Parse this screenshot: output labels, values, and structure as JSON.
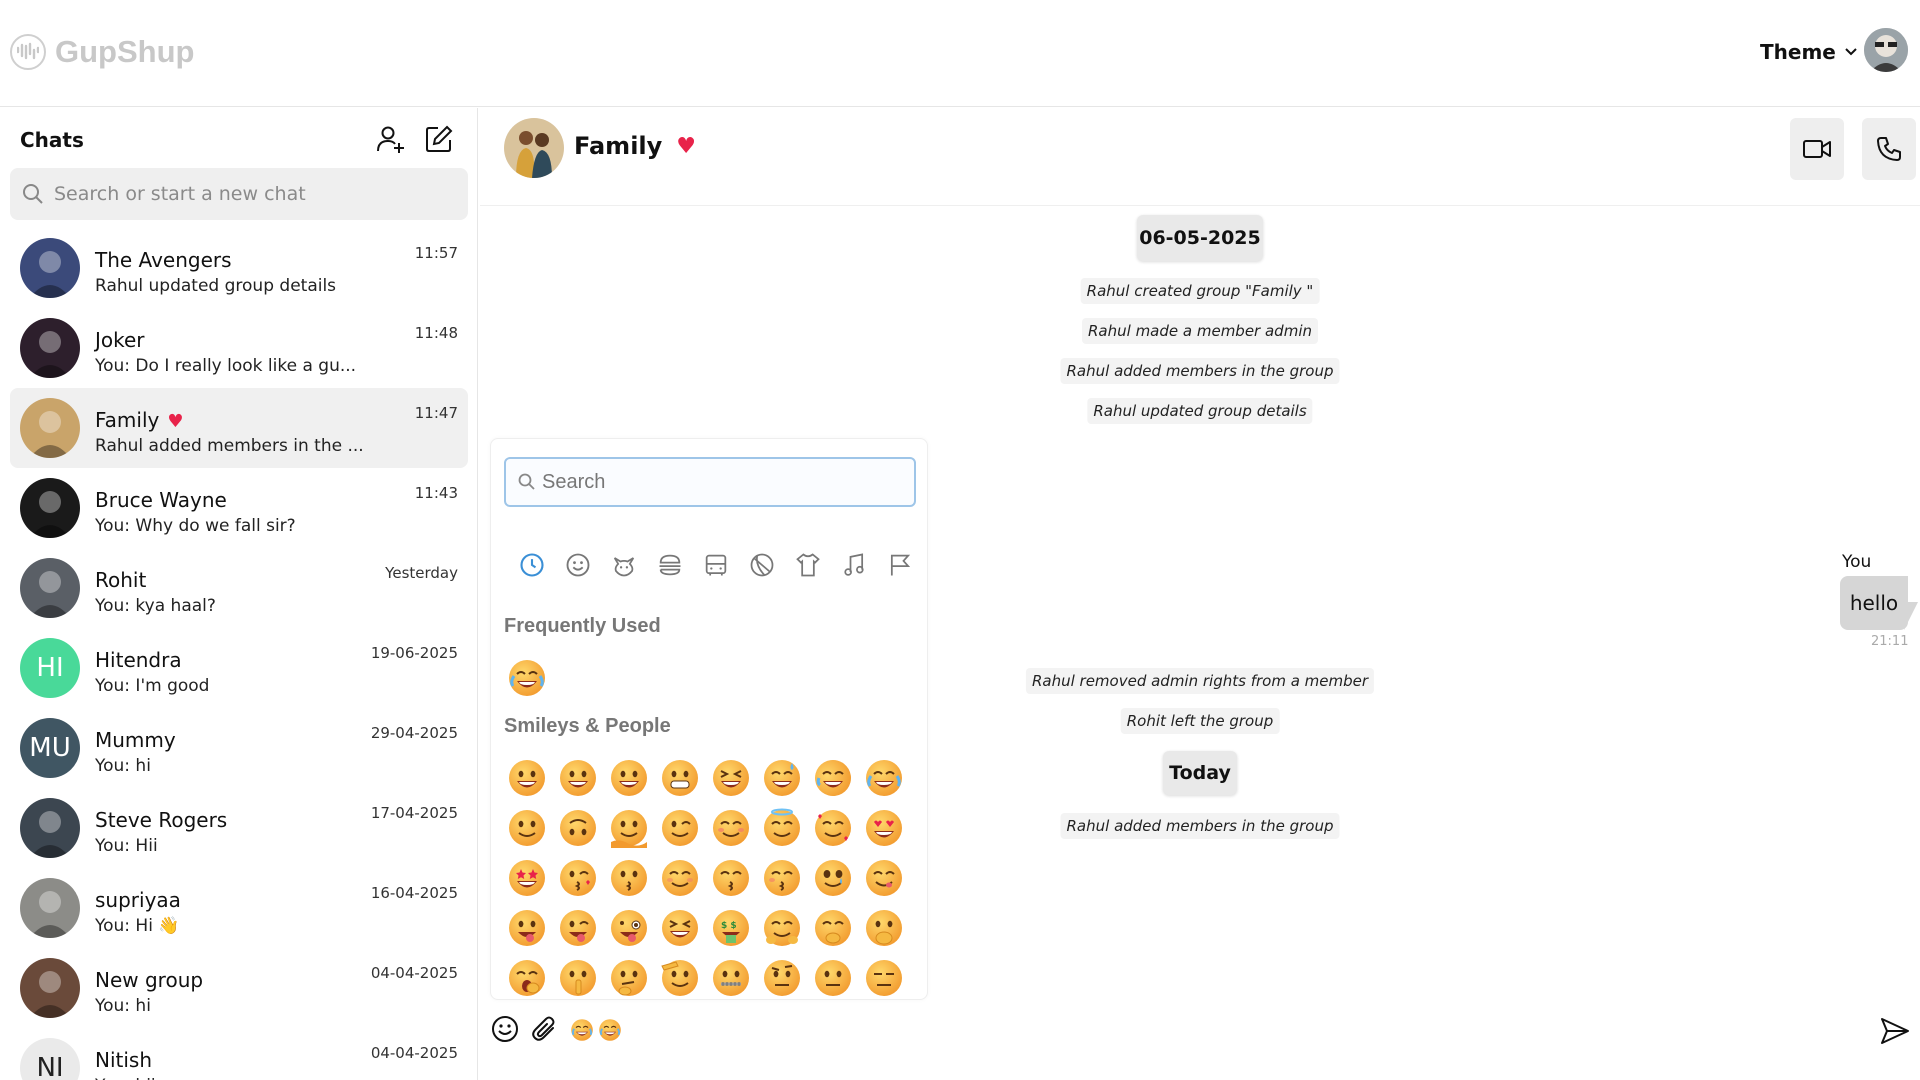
{
  "app": {
    "name": "GupShup"
  },
  "header": {
    "theme_label": "Theme"
  },
  "sidebar": {
    "title": "Chats",
    "search_placeholder": "Search or start a new chat",
    "chats": [
      {
        "name": "The Avengers",
        "preview": "Rahul updated group details",
        "time": "11:57",
        "avatar": "photo",
        "color": "#3b4a7a"
      },
      {
        "name": "Joker",
        "preview": "You: Do I really look like a gu...",
        "time": "11:48",
        "avatar": "photo",
        "color": "#2d1f2c"
      },
      {
        "name": "Family",
        "preview": "Rahul added members in the ...",
        "time": "11:47",
        "avatar": "photo",
        "color": "#c9a46a",
        "heart": true,
        "active": true
      },
      {
        "name": "Bruce Wayne",
        "preview": "You: Why do we fall sir?",
        "time": "11:43",
        "avatar": "photo",
        "color": "#1a1a1a"
      },
      {
        "name": "Rohit",
        "preview": "You: kya haal?",
        "time": "Yesterday",
        "avatar": "photo",
        "color": "#5a5f66"
      },
      {
        "name": "Hitendra",
        "preview": "You: I'm good",
        "time": "19-06-2025",
        "initials": "HI",
        "color": "#49d999"
      },
      {
        "name": "Mummy",
        "preview": "You: hi",
        "time": "29-04-2025",
        "initials": "MU",
        "color": "#405663"
      },
      {
        "name": "Steve Rogers",
        "preview": "You: Hii",
        "time": "17-04-2025",
        "avatar": "photo",
        "color": "#3c4650"
      },
      {
        "name": "supriyaa",
        "preview": "You: Hi 👋",
        "time": "16-04-2025",
        "avatar": "photo",
        "color": "#8c8c88"
      },
      {
        "name": "New group",
        "preview": "You: hi",
        "time": "04-04-2025",
        "avatar": "photo",
        "color": "#6a4a3a"
      },
      {
        "name": "Nitish",
        "preview": "You: hii",
        "time": "04-04-2025",
        "initials": "NI",
        "color": "#eaeaea"
      }
    ]
  },
  "conversation": {
    "title": "Family",
    "date_pill": "06-05-2025",
    "today_pill": "Today",
    "system_messages_top": [
      "Rahul created group \"Family \"",
      "Rahul made a member admin",
      "Rahul added members in the group",
      "Rahul updated group details"
    ],
    "system_messages_mid": [
      "Rahul removed admin rights from a member",
      "Rohit left the group"
    ],
    "system_messages_bottom": [
      "Rahul added members in the group"
    ],
    "outgoing": {
      "sender": "You",
      "text": "hello",
      "time": "21:11"
    }
  },
  "emoji_picker": {
    "search_placeholder": "Search",
    "categories": [
      "recent-icon",
      "smiley-icon",
      "cat-icon",
      "burger-icon",
      "bus-icon",
      "ball-icon",
      "shirt-icon",
      "music-icon",
      "flag-icon"
    ],
    "frequently_used_label": "Frequently Used",
    "smileys_label": "Smileys & People"
  },
  "colors": {
    "accent_blue": "#3a8fd6",
    "heart": "#e8234a",
    "emoji_yellow": "#f7b731"
  }
}
